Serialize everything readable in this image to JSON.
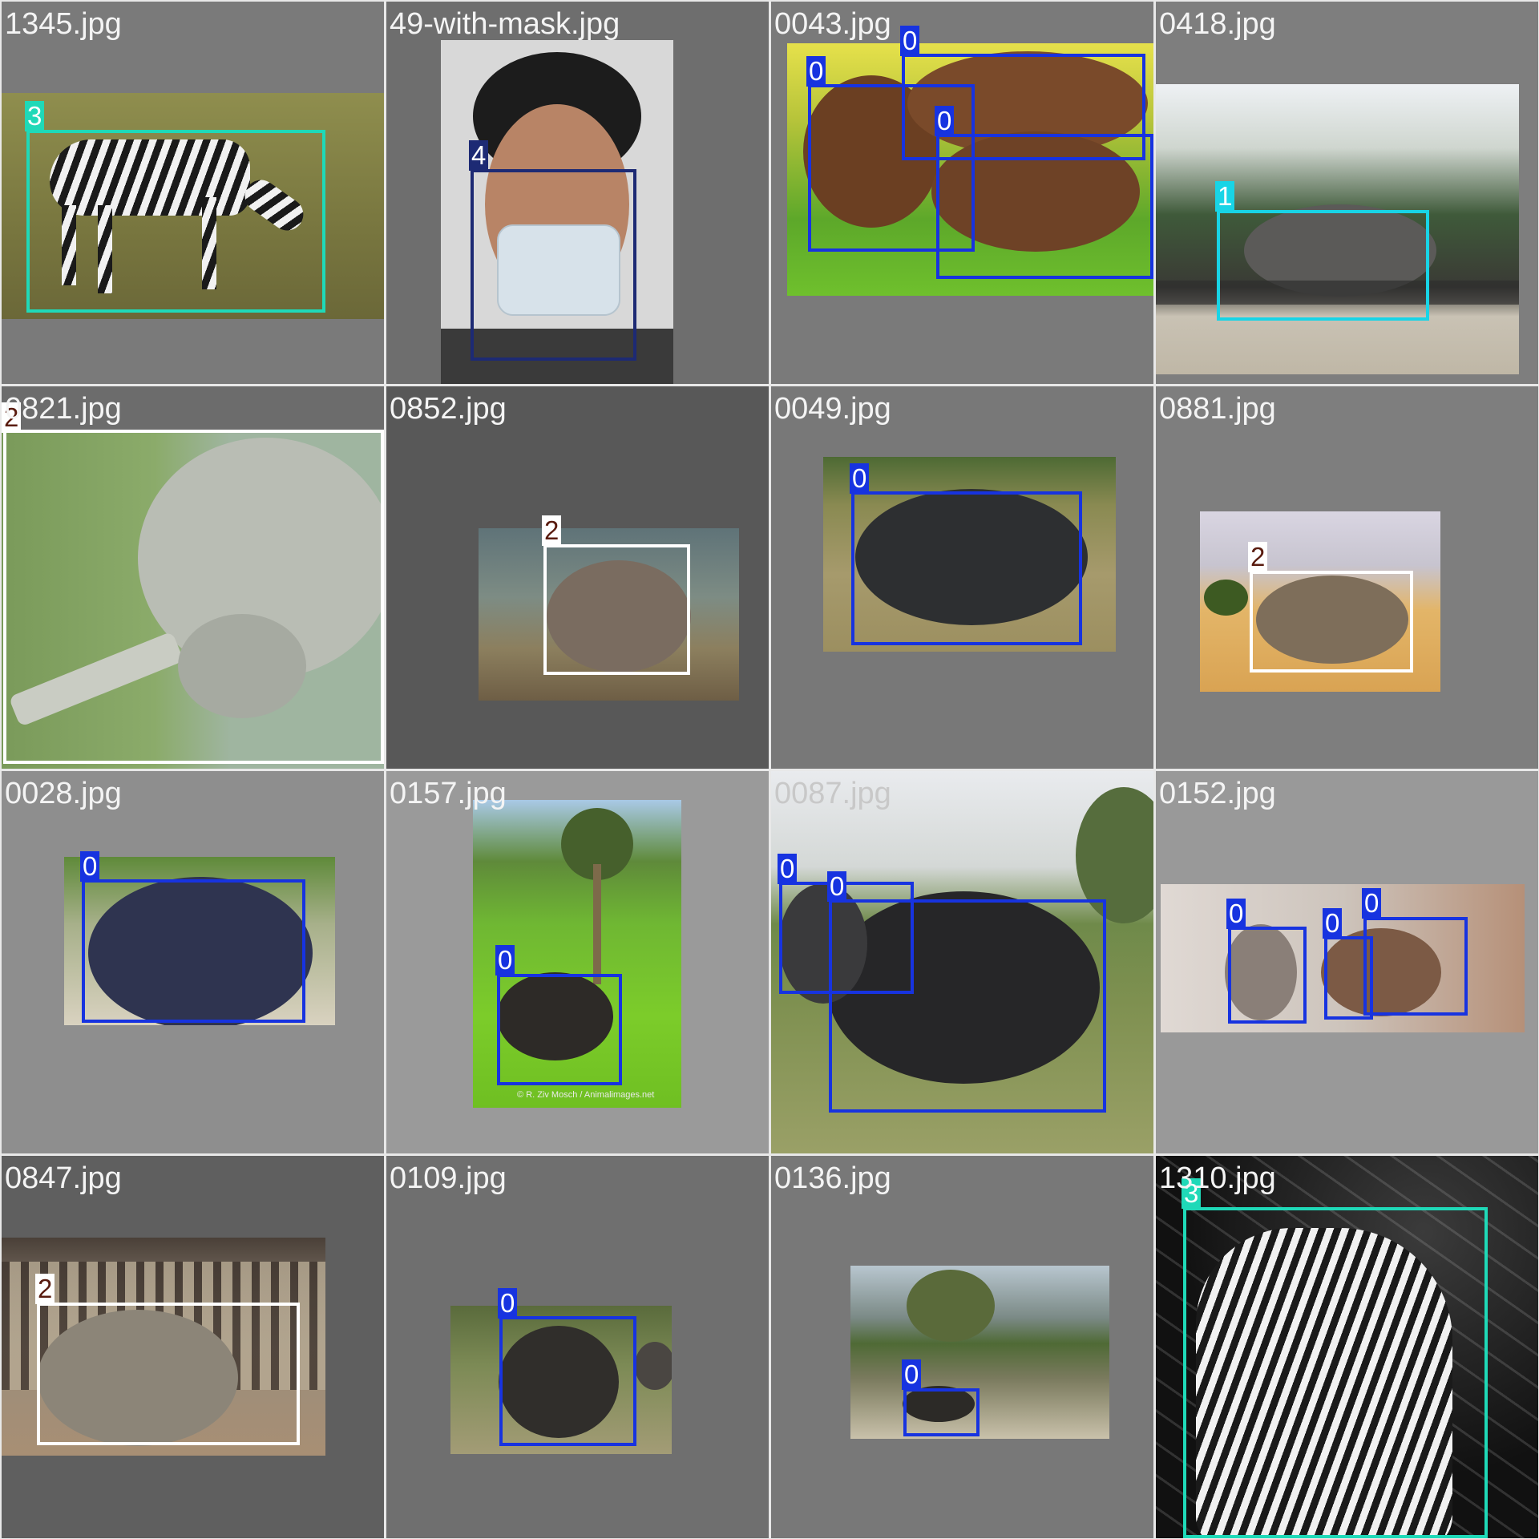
{
  "grid": {
    "tiles": [
      {
        "filename": "1345.jpg",
        "labels": [
          "3"
        ]
      },
      {
        "filename": "49-with-mask.jpg",
        "labels": [
          "4"
        ]
      },
      {
        "filename": "0043.jpg",
        "labels": [
          "0",
          "0",
          "0"
        ]
      },
      {
        "filename": "0418.jpg",
        "labels": [
          "1"
        ]
      },
      {
        "filename": "0821.jpg",
        "labels": [
          "2"
        ]
      },
      {
        "filename": "0852.jpg",
        "labels": [
          "2"
        ]
      },
      {
        "filename": "0049.jpg",
        "labels": [
          "0"
        ]
      },
      {
        "filename": "0881.jpg",
        "labels": [
          "2"
        ]
      },
      {
        "filename": "0028.jpg",
        "labels": [
          "0"
        ]
      },
      {
        "filename": "0157.jpg",
        "labels": [
          "0"
        ]
      },
      {
        "filename": "0087.jpg",
        "labels": [
          "0",
          "0"
        ]
      },
      {
        "filename": "0152.jpg",
        "labels": [
          "0",
          "0",
          "0"
        ]
      },
      {
        "filename": "0847.jpg",
        "labels": [
          "2"
        ]
      },
      {
        "filename": "0109.jpg",
        "labels": [
          "0"
        ]
      },
      {
        "filename": "0136.jpg",
        "labels": [
          "0"
        ]
      },
      {
        "filename": "1310.jpg",
        "labels": [
          "3"
        ]
      }
    ]
  },
  "photo_credit": "© R. Ziv Mosch / Animalimages.net",
  "class_colors": {
    "0": "#1733e0",
    "1": "#18d4e6",
    "2": "#ffffff",
    "3": "#1fd9b8",
    "4": "#1d2a74"
  }
}
